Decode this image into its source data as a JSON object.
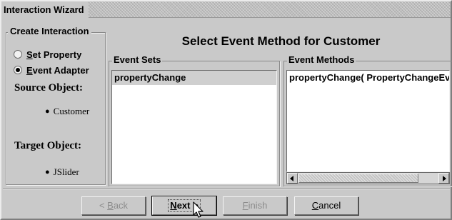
{
  "window": {
    "title": "Interaction Wizard"
  },
  "create_interaction": {
    "legend": "Create Interaction",
    "options": [
      {
        "mnemonic": "S",
        "rest": "et Property",
        "checked": false
      },
      {
        "mnemonic": "E",
        "rest": "vent Adapter",
        "checked": true
      }
    ]
  },
  "source": {
    "label": "Source Object:",
    "value": "Customer"
  },
  "target": {
    "label": "Target Object:",
    "value": "JSlider"
  },
  "heading": "Select Event Method for Customer",
  "event_sets": {
    "legend": "Event Sets",
    "items": [
      "propertyChange"
    ]
  },
  "event_methods": {
    "legend": "Event Methods",
    "items": [
      "propertyChange( PropertyChangeEv"
    ]
  },
  "buttons": {
    "back": {
      "prefix": "< ",
      "mnemonic": "B",
      "rest": "ack",
      "enabled": false
    },
    "next": {
      "mnemonic": "N",
      "rest": "ext >",
      "enabled": true
    },
    "finish": {
      "mnemonic": "F",
      "rest": "inish",
      "enabled": false
    },
    "cancel": {
      "mnemonic": "C",
      "rest": "ancel",
      "enabled": true
    }
  },
  "icons": {
    "radio": "radio-icon",
    "bullet": "bullet-icon",
    "scroll_left": "arrow-left-icon",
    "scroll_right": "arrow-right-icon",
    "cursor": "mouse-pointer-icon"
  },
  "colors": {
    "dialog_bg": "#c9c9c9",
    "list_bg": "#ffffff",
    "selection_bg": "#cfcfcf"
  }
}
